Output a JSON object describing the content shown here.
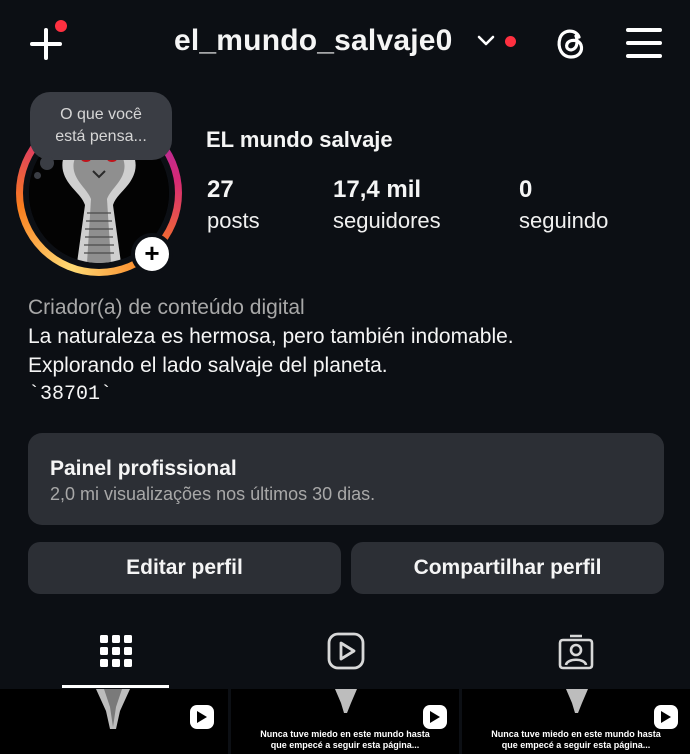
{
  "header": {
    "username": "el_mundo_salvaje0",
    "accent_red": "#ff3040",
    "icons": [
      "add-icon",
      "chevron-down-icon",
      "threads-icon",
      "hamburger-menu-icon"
    ]
  },
  "profile": {
    "note": [
      "O que você",
      "está pensa..."
    ],
    "display_name": "EL mundo salvaje",
    "stats": [
      {
        "value": "27",
        "label": "posts"
      },
      {
        "value": "17,4 mil",
        "label": "seguidores"
      },
      {
        "value": "0",
        "label": "seguindo"
      }
    ],
    "add_story_label": "+",
    "story_ring_colors": [
      "#feda75",
      "#fa7e1e",
      "#d62976",
      "#962fbf"
    ]
  },
  "bio": {
    "category": "Criador(a) de conteúdo digital",
    "line1": "La naturaleza es hermosa, pero también indomable.",
    "line2": "Explorando el lado salvaje del planeta.",
    "line3": "`38701`"
  },
  "dashboard": {
    "title": "Painel profissional",
    "subtitle": "2,0 mi visualizações nos últimos 30 dias."
  },
  "actions": {
    "edit": "Editar perfil",
    "share": "Compartilhar perfil"
  },
  "tabs": [
    {
      "name": "grid-icon",
      "active": true
    },
    {
      "name": "reels-icon",
      "active": false
    },
    {
      "name": "tagged-icon",
      "active": false
    }
  ],
  "grid": [
    {
      "caption1": "",
      "caption2": "",
      "badge": "reel-icon"
    },
    {
      "caption1": "Nunca tuve miedo en este mundo hasta",
      "caption2": "que empecé a seguir esta página...",
      "badge": "reel-icon"
    },
    {
      "caption1": "Nunca tuve miedo en este mundo hasta",
      "caption2": "que empecé a seguir esta página...",
      "badge": "reel-icon"
    }
  ]
}
